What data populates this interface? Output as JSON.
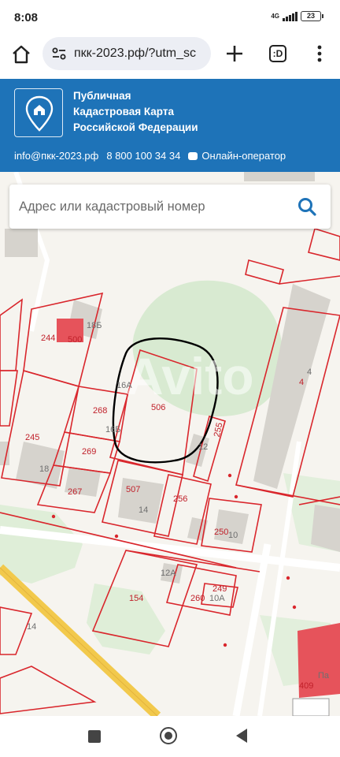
{
  "status_bar": {
    "time": "8:08",
    "network": "4G",
    "battery": "23"
  },
  "browser": {
    "url": "пкк-2023.рф/?utm_sc",
    "tabs_label": ":D"
  },
  "site": {
    "title_line1": "Публичная",
    "title_line2": "Кадастровая Карта",
    "title_line3": "Российской Федерации",
    "email": "info@пкк-2023.рф",
    "phone": "8 800 100 34 34",
    "chat_label": "Онлайн-оператор"
  },
  "search": {
    "placeholder": "Адрес или кадастровый номер"
  },
  "map": {
    "parcel_labels": [
      "244",
      "500",
      "268",
      "506",
      "255",
      "245",
      "269",
      "267",
      "507",
      "256",
      "250",
      "154",
      "260",
      "249",
      "4",
      "409"
    ],
    "building_labels": [
      "18Б",
      "16А",
      "16Б",
      "12",
      "18",
      "14",
      "10",
      "12А",
      "10А",
      "4",
      "14",
      "Па"
    ],
    "watermark": "Avito",
    "colors": {
      "parcel_border": "#d9262c",
      "building_fill": "#d6d3cd",
      "green_area": "#d8ead1",
      "highlight_building": "#e6535b",
      "road": "#f2c94c",
      "annotation_circle": "#000000"
    }
  },
  "nav": {
    "back_icon": "square-icon",
    "home_icon": "circle-icon",
    "recents_icon": "triangle-icon"
  }
}
